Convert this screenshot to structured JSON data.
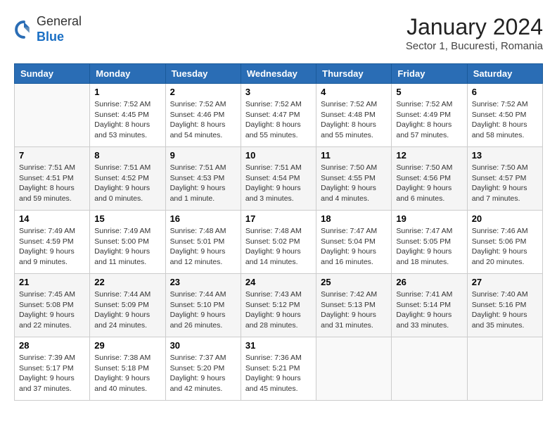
{
  "header": {
    "logo": {
      "general": "General",
      "blue": "Blue"
    },
    "title": "January 2024",
    "location": "Sector 1, Bucuresti, Romania"
  },
  "weekdays": [
    "Sunday",
    "Monday",
    "Tuesday",
    "Wednesday",
    "Thursday",
    "Friday",
    "Saturday"
  ],
  "weeks": [
    [
      {
        "day": null
      },
      {
        "day": 1,
        "sunrise": "Sunrise: 7:52 AM",
        "sunset": "Sunset: 4:45 PM",
        "daylight": "Daylight: 8 hours and 53 minutes."
      },
      {
        "day": 2,
        "sunrise": "Sunrise: 7:52 AM",
        "sunset": "Sunset: 4:46 PM",
        "daylight": "Daylight: 8 hours and 54 minutes."
      },
      {
        "day": 3,
        "sunrise": "Sunrise: 7:52 AM",
        "sunset": "Sunset: 4:47 PM",
        "daylight": "Daylight: 8 hours and 55 minutes."
      },
      {
        "day": 4,
        "sunrise": "Sunrise: 7:52 AM",
        "sunset": "Sunset: 4:48 PM",
        "daylight": "Daylight: 8 hours and 55 minutes."
      },
      {
        "day": 5,
        "sunrise": "Sunrise: 7:52 AM",
        "sunset": "Sunset: 4:49 PM",
        "daylight": "Daylight: 8 hours and 57 minutes."
      },
      {
        "day": 6,
        "sunrise": "Sunrise: 7:52 AM",
        "sunset": "Sunset: 4:50 PM",
        "daylight": "Daylight: 8 hours and 58 minutes."
      }
    ],
    [
      {
        "day": 7,
        "sunrise": "Sunrise: 7:51 AM",
        "sunset": "Sunset: 4:51 PM",
        "daylight": "Daylight: 8 hours and 59 minutes."
      },
      {
        "day": 8,
        "sunrise": "Sunrise: 7:51 AM",
        "sunset": "Sunset: 4:52 PM",
        "daylight": "Daylight: 9 hours and 0 minutes."
      },
      {
        "day": 9,
        "sunrise": "Sunrise: 7:51 AM",
        "sunset": "Sunset: 4:53 PM",
        "daylight": "Daylight: 9 hours and 1 minute."
      },
      {
        "day": 10,
        "sunrise": "Sunrise: 7:51 AM",
        "sunset": "Sunset: 4:54 PM",
        "daylight": "Daylight: 9 hours and 3 minutes."
      },
      {
        "day": 11,
        "sunrise": "Sunrise: 7:50 AM",
        "sunset": "Sunset: 4:55 PM",
        "daylight": "Daylight: 9 hours and 4 minutes."
      },
      {
        "day": 12,
        "sunrise": "Sunrise: 7:50 AM",
        "sunset": "Sunset: 4:56 PM",
        "daylight": "Daylight: 9 hours and 6 minutes."
      },
      {
        "day": 13,
        "sunrise": "Sunrise: 7:50 AM",
        "sunset": "Sunset: 4:57 PM",
        "daylight": "Daylight: 9 hours and 7 minutes."
      }
    ],
    [
      {
        "day": 14,
        "sunrise": "Sunrise: 7:49 AM",
        "sunset": "Sunset: 4:59 PM",
        "daylight": "Daylight: 9 hours and 9 minutes."
      },
      {
        "day": 15,
        "sunrise": "Sunrise: 7:49 AM",
        "sunset": "Sunset: 5:00 PM",
        "daylight": "Daylight: 9 hours and 11 minutes."
      },
      {
        "day": 16,
        "sunrise": "Sunrise: 7:48 AM",
        "sunset": "Sunset: 5:01 PM",
        "daylight": "Daylight: 9 hours and 12 minutes."
      },
      {
        "day": 17,
        "sunrise": "Sunrise: 7:48 AM",
        "sunset": "Sunset: 5:02 PM",
        "daylight": "Daylight: 9 hours and 14 minutes."
      },
      {
        "day": 18,
        "sunrise": "Sunrise: 7:47 AM",
        "sunset": "Sunset: 5:04 PM",
        "daylight": "Daylight: 9 hours and 16 minutes."
      },
      {
        "day": 19,
        "sunrise": "Sunrise: 7:47 AM",
        "sunset": "Sunset: 5:05 PM",
        "daylight": "Daylight: 9 hours and 18 minutes."
      },
      {
        "day": 20,
        "sunrise": "Sunrise: 7:46 AM",
        "sunset": "Sunset: 5:06 PM",
        "daylight": "Daylight: 9 hours and 20 minutes."
      }
    ],
    [
      {
        "day": 21,
        "sunrise": "Sunrise: 7:45 AM",
        "sunset": "Sunset: 5:08 PM",
        "daylight": "Daylight: 9 hours and 22 minutes."
      },
      {
        "day": 22,
        "sunrise": "Sunrise: 7:44 AM",
        "sunset": "Sunset: 5:09 PM",
        "daylight": "Daylight: 9 hours and 24 minutes."
      },
      {
        "day": 23,
        "sunrise": "Sunrise: 7:44 AM",
        "sunset": "Sunset: 5:10 PM",
        "daylight": "Daylight: 9 hours and 26 minutes."
      },
      {
        "day": 24,
        "sunrise": "Sunrise: 7:43 AM",
        "sunset": "Sunset: 5:12 PM",
        "daylight": "Daylight: 9 hours and 28 minutes."
      },
      {
        "day": 25,
        "sunrise": "Sunrise: 7:42 AM",
        "sunset": "Sunset: 5:13 PM",
        "daylight": "Daylight: 9 hours and 31 minutes."
      },
      {
        "day": 26,
        "sunrise": "Sunrise: 7:41 AM",
        "sunset": "Sunset: 5:14 PM",
        "daylight": "Daylight: 9 hours and 33 minutes."
      },
      {
        "day": 27,
        "sunrise": "Sunrise: 7:40 AM",
        "sunset": "Sunset: 5:16 PM",
        "daylight": "Daylight: 9 hours and 35 minutes."
      }
    ],
    [
      {
        "day": 28,
        "sunrise": "Sunrise: 7:39 AM",
        "sunset": "Sunset: 5:17 PM",
        "daylight": "Daylight: 9 hours and 37 minutes."
      },
      {
        "day": 29,
        "sunrise": "Sunrise: 7:38 AM",
        "sunset": "Sunset: 5:18 PM",
        "daylight": "Daylight: 9 hours and 40 minutes."
      },
      {
        "day": 30,
        "sunrise": "Sunrise: 7:37 AM",
        "sunset": "Sunset: 5:20 PM",
        "daylight": "Daylight: 9 hours and 42 minutes."
      },
      {
        "day": 31,
        "sunrise": "Sunrise: 7:36 AM",
        "sunset": "Sunset: 5:21 PM",
        "daylight": "Daylight: 9 hours and 45 minutes."
      },
      {
        "day": null
      },
      {
        "day": null
      },
      {
        "day": null
      }
    ]
  ]
}
